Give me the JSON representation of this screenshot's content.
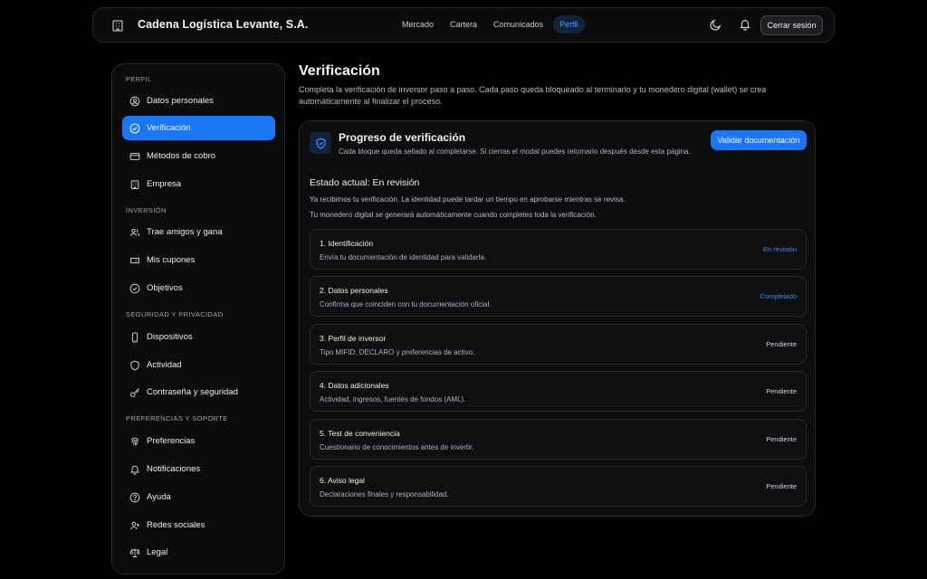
{
  "header": {
    "company": "Cadena Logística Levante, S.A.",
    "nav": [
      "Mercado",
      "Cartera",
      "Comunicados",
      "Perfil"
    ],
    "active_nav": "Perfil",
    "logout": "Cerrar sesión"
  },
  "sidebar": {
    "sections": [
      "PERFIL",
      "INVERSIÓN",
      "SEGURIDAD Y PRIVACIDAD",
      "PREFERENCIAS Y SOPORTE"
    ],
    "items": [
      {
        "label": "Datos personales",
        "icon": "user-circle-icon"
      },
      {
        "label": "Verificación",
        "icon": "check-circle-icon",
        "active": true
      },
      {
        "label": "Métodos de cobro",
        "icon": "credit-card-icon"
      },
      {
        "label": "Empresa",
        "icon": "building-icon"
      },
      {
        "label": "Trae amigos y gana",
        "icon": "users-icon"
      },
      {
        "label": "Mis cupones",
        "icon": "ticket-icon"
      },
      {
        "label": "Objetivos",
        "icon": "target-icon"
      },
      {
        "label": "Dispositivos",
        "icon": "phone-icon"
      },
      {
        "label": "Actividad",
        "icon": "shield-icon"
      },
      {
        "label": "Contraseña y seguridad",
        "icon": "key-icon"
      },
      {
        "label": "Preferencias",
        "icon": "fingerprint-icon"
      },
      {
        "label": "Notificaciones",
        "icon": "bell-icon"
      },
      {
        "label": "Ayuda",
        "icon": "help-icon"
      },
      {
        "label": "Redes sociales",
        "icon": "user-plus-icon"
      },
      {
        "label": "Legal",
        "icon": "scale-icon"
      }
    ]
  },
  "main": {
    "title": "Verificación",
    "description": "Completa la verificación de inversor paso a paso. Cada paso queda bloqueado al terminarlo y tu monedero digital (wallet) se crea automáticamente al finalizar el proceso.",
    "card": {
      "title": "Progreso de verificación",
      "subtitle": "Cada bloque queda sellado al completarse. Si cierras el modal puedes retomarlo después desde esta página.",
      "button": "Validar documentación",
      "state": "Estado actual: En revisión",
      "notes": [
        "Ya recibimos tu verificación. La identidad puede tardar un tiempo en aprobarse mientras se revisa.",
        "Tu monedero digital se generará automáticamente cuando completes toda la verificación."
      ],
      "steps": [
        {
          "title": "1. Identificación",
          "desc": "Envía tu documentación de identidad para validarla.",
          "status": "En revisión"
        },
        {
          "title": "2. Datos personales",
          "desc": "Confirma que coinciden con tu documentación oficial.",
          "status": "Completado"
        },
        {
          "title": "3. Perfil de inversor",
          "desc": "Tipo MIFID, DECLARO y preferencias de activo.",
          "status": "Pendiente"
        },
        {
          "title": "4. Datos adicionales",
          "desc": "Actividad, ingresos, fuentes de fondos (AML).",
          "status": "Pendiente"
        },
        {
          "title": "5. Test de conveniencia",
          "desc": "Cuestionario de conocimientos antes de invertir.",
          "status": "Pendiente"
        },
        {
          "title": "6. Aviso legal",
          "desc": "Declaraciones finales y responsabilidad.",
          "status": "Pendiente"
        }
      ]
    }
  },
  "colors": {
    "accent": "#1a76f2",
    "accent_text": "#4d9bff",
    "background": "#000000",
    "panel": "#0b0b0c"
  }
}
